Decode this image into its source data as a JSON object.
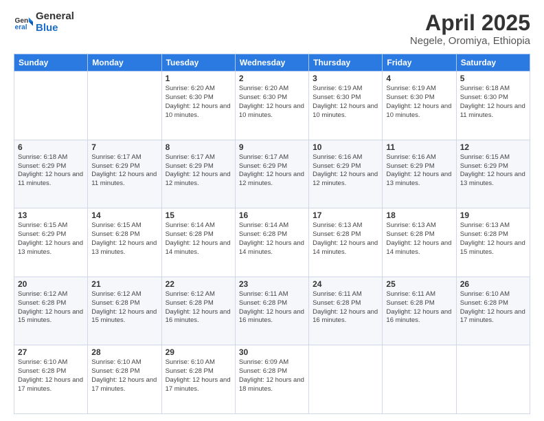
{
  "logo": {
    "line1": "General",
    "line2": "Blue"
  },
  "header": {
    "month_year": "April 2025",
    "location": "Negele, Oromiya, Ethiopia"
  },
  "weekdays": [
    "Sunday",
    "Monday",
    "Tuesday",
    "Wednesday",
    "Thursday",
    "Friday",
    "Saturday"
  ],
  "weeks": [
    [
      {
        "day": "",
        "info": ""
      },
      {
        "day": "",
        "info": ""
      },
      {
        "day": "1",
        "info": "Sunrise: 6:20 AM\nSunset: 6:30 PM\nDaylight: 12 hours and 10 minutes."
      },
      {
        "day": "2",
        "info": "Sunrise: 6:20 AM\nSunset: 6:30 PM\nDaylight: 12 hours and 10 minutes."
      },
      {
        "day": "3",
        "info": "Sunrise: 6:19 AM\nSunset: 6:30 PM\nDaylight: 12 hours and 10 minutes."
      },
      {
        "day": "4",
        "info": "Sunrise: 6:19 AM\nSunset: 6:30 PM\nDaylight: 12 hours and 10 minutes."
      },
      {
        "day": "5",
        "info": "Sunrise: 6:18 AM\nSunset: 6:30 PM\nDaylight: 12 hours and 11 minutes."
      }
    ],
    [
      {
        "day": "6",
        "info": "Sunrise: 6:18 AM\nSunset: 6:29 PM\nDaylight: 12 hours and 11 minutes."
      },
      {
        "day": "7",
        "info": "Sunrise: 6:17 AM\nSunset: 6:29 PM\nDaylight: 12 hours and 11 minutes."
      },
      {
        "day": "8",
        "info": "Sunrise: 6:17 AM\nSunset: 6:29 PM\nDaylight: 12 hours and 12 minutes."
      },
      {
        "day": "9",
        "info": "Sunrise: 6:17 AM\nSunset: 6:29 PM\nDaylight: 12 hours and 12 minutes."
      },
      {
        "day": "10",
        "info": "Sunrise: 6:16 AM\nSunset: 6:29 PM\nDaylight: 12 hours and 12 minutes."
      },
      {
        "day": "11",
        "info": "Sunrise: 6:16 AM\nSunset: 6:29 PM\nDaylight: 12 hours and 13 minutes."
      },
      {
        "day": "12",
        "info": "Sunrise: 6:15 AM\nSunset: 6:29 PM\nDaylight: 12 hours and 13 minutes."
      }
    ],
    [
      {
        "day": "13",
        "info": "Sunrise: 6:15 AM\nSunset: 6:29 PM\nDaylight: 12 hours and 13 minutes."
      },
      {
        "day": "14",
        "info": "Sunrise: 6:15 AM\nSunset: 6:28 PM\nDaylight: 12 hours and 13 minutes."
      },
      {
        "day": "15",
        "info": "Sunrise: 6:14 AM\nSunset: 6:28 PM\nDaylight: 12 hours and 14 minutes."
      },
      {
        "day": "16",
        "info": "Sunrise: 6:14 AM\nSunset: 6:28 PM\nDaylight: 12 hours and 14 minutes."
      },
      {
        "day": "17",
        "info": "Sunrise: 6:13 AM\nSunset: 6:28 PM\nDaylight: 12 hours and 14 minutes."
      },
      {
        "day": "18",
        "info": "Sunrise: 6:13 AM\nSunset: 6:28 PM\nDaylight: 12 hours and 14 minutes."
      },
      {
        "day": "19",
        "info": "Sunrise: 6:13 AM\nSunset: 6:28 PM\nDaylight: 12 hours and 15 minutes."
      }
    ],
    [
      {
        "day": "20",
        "info": "Sunrise: 6:12 AM\nSunset: 6:28 PM\nDaylight: 12 hours and 15 minutes."
      },
      {
        "day": "21",
        "info": "Sunrise: 6:12 AM\nSunset: 6:28 PM\nDaylight: 12 hours and 15 minutes."
      },
      {
        "day": "22",
        "info": "Sunrise: 6:12 AM\nSunset: 6:28 PM\nDaylight: 12 hours and 16 minutes."
      },
      {
        "day": "23",
        "info": "Sunrise: 6:11 AM\nSunset: 6:28 PM\nDaylight: 12 hours and 16 minutes."
      },
      {
        "day": "24",
        "info": "Sunrise: 6:11 AM\nSunset: 6:28 PM\nDaylight: 12 hours and 16 minutes."
      },
      {
        "day": "25",
        "info": "Sunrise: 6:11 AM\nSunset: 6:28 PM\nDaylight: 12 hours and 16 minutes."
      },
      {
        "day": "26",
        "info": "Sunrise: 6:10 AM\nSunset: 6:28 PM\nDaylight: 12 hours and 17 minutes."
      }
    ],
    [
      {
        "day": "27",
        "info": "Sunrise: 6:10 AM\nSunset: 6:28 PM\nDaylight: 12 hours and 17 minutes."
      },
      {
        "day": "28",
        "info": "Sunrise: 6:10 AM\nSunset: 6:28 PM\nDaylight: 12 hours and 17 minutes."
      },
      {
        "day": "29",
        "info": "Sunrise: 6:10 AM\nSunset: 6:28 PM\nDaylight: 12 hours and 17 minutes."
      },
      {
        "day": "30",
        "info": "Sunrise: 6:09 AM\nSunset: 6:28 PM\nDaylight: 12 hours and 18 minutes."
      },
      {
        "day": "",
        "info": ""
      },
      {
        "day": "",
        "info": ""
      },
      {
        "day": "",
        "info": ""
      }
    ]
  ]
}
